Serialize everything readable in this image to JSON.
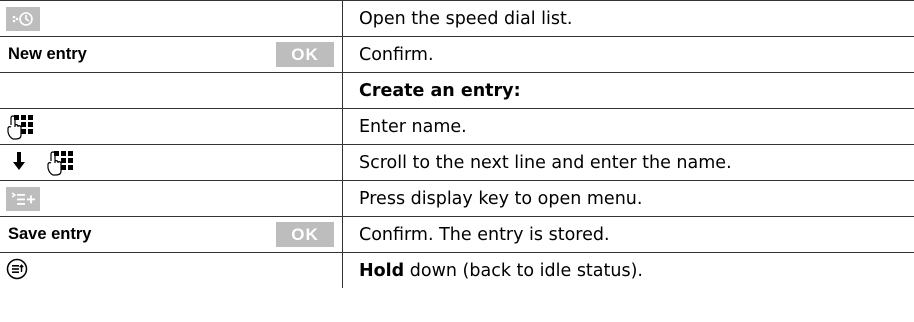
{
  "rows": [
    {
      "icon": "speed-dial-key-icon",
      "label": "",
      "ok": "",
      "action": "Open the speed dial list."
    },
    {
      "icon": "",
      "label": "New entry",
      "ok": "OK",
      "action": "Confirm."
    },
    {
      "icon": "",
      "label": "",
      "ok": "",
      "action": "Create an entry:"
    },
    {
      "icon": "keypad-icon",
      "label": "",
      "ok": "",
      "action": "Enter name."
    },
    {
      "icon": "scroll-down-keypad-icon",
      "label": "",
      "ok": "",
      "action": "Scroll to the next line and enter the name."
    },
    {
      "icon": "menu-display-key-icon",
      "label": "",
      "ok": "",
      "action": "Press display key to open menu."
    },
    {
      "icon": "",
      "label": "Save entry",
      "ok": "OK",
      "action": "Confirm. The entry is stored."
    },
    {
      "icon": "end-call-key-icon",
      "label": "",
      "ok": "",
      "action_bold": "Hold",
      "action_rest": " down (back to idle status)."
    }
  ],
  "colors": {
    "key_grey": "#bdbdbd",
    "rule": "#333333"
  }
}
